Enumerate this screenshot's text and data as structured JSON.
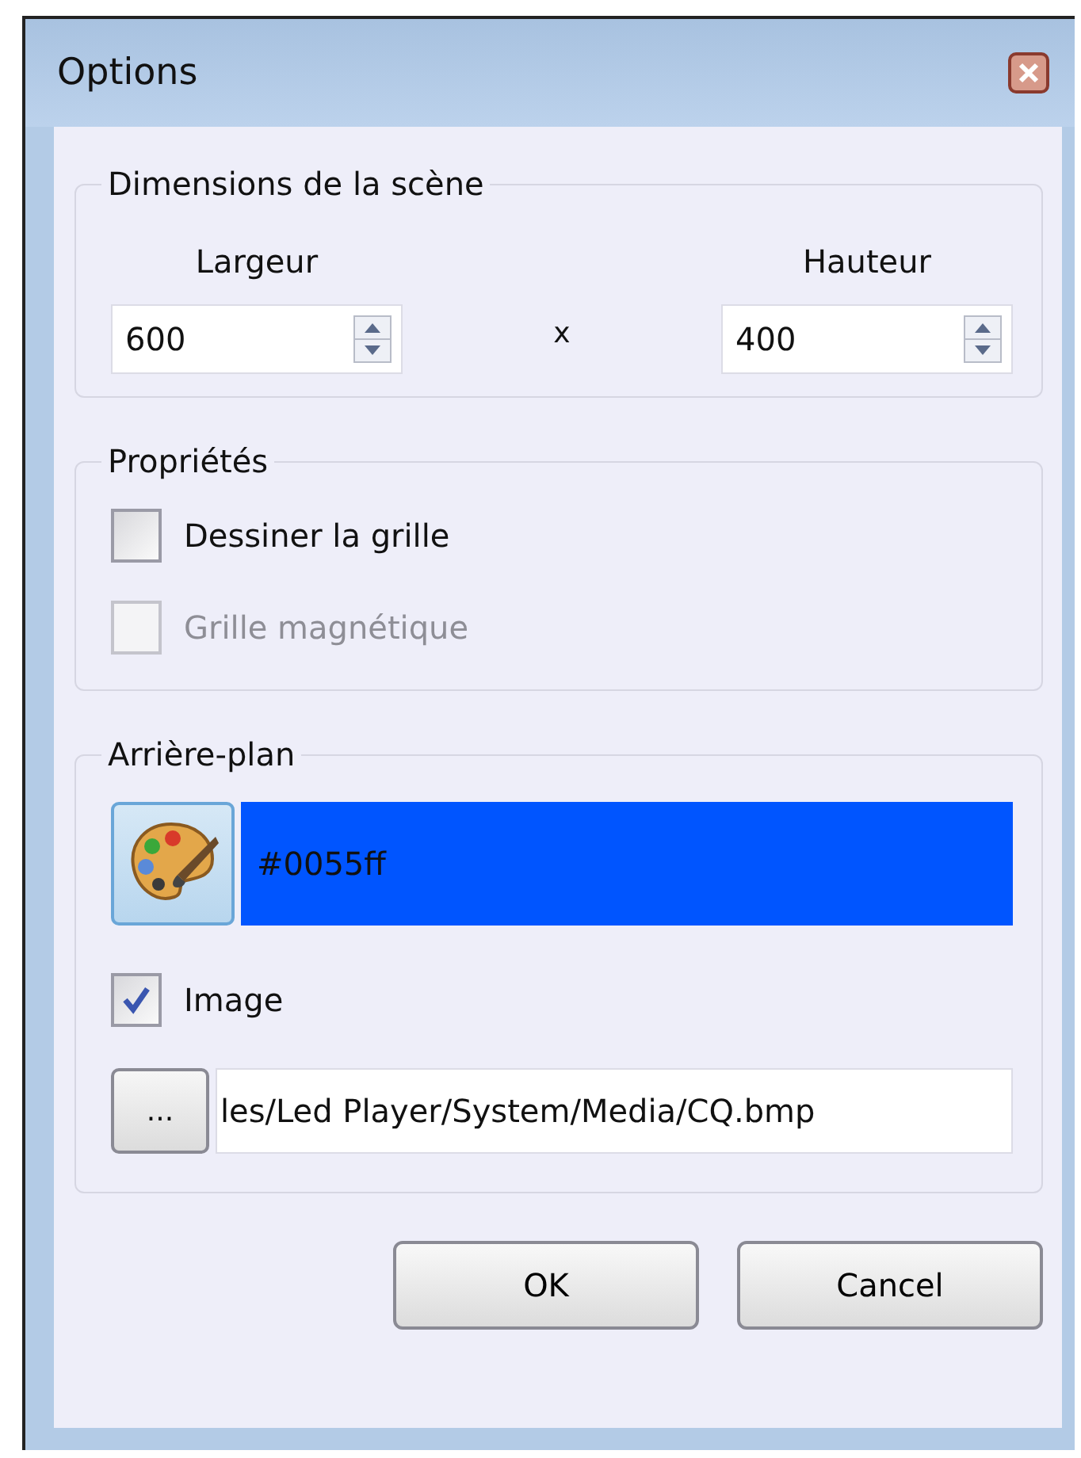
{
  "window": {
    "title": "Options"
  },
  "dimensions": {
    "title": "Dimensions de la scène",
    "separator": "x",
    "fields": [
      {
        "label": "Largeur",
        "value": "600"
      },
      {
        "label": "Hauteur",
        "value": "400"
      }
    ]
  },
  "properties": {
    "title": "Propriétés",
    "options": [
      {
        "label": "Dessiner la grille",
        "checked": false,
        "disabled": false
      },
      {
        "label": "Grille magnétique",
        "checked": false,
        "disabled": true
      }
    ]
  },
  "background": {
    "title": "Arrière-plan",
    "color": "#0055ff",
    "color_text": "#0055ff",
    "image_option": {
      "label": "Image",
      "checked": true,
      "disabled": false
    },
    "browse_button": "...",
    "image_path": "les/Led Player/System/Media/CQ.bmp"
  },
  "buttons": [
    "OK",
    "Cancel"
  ]
}
